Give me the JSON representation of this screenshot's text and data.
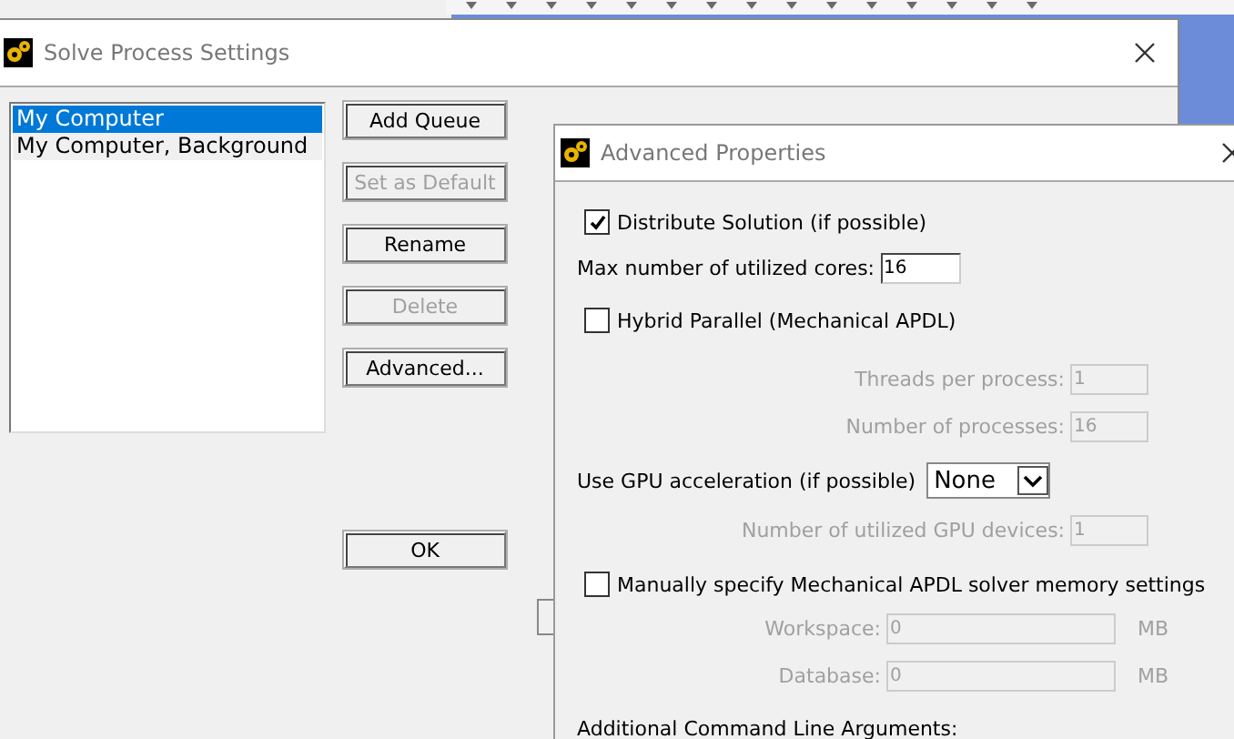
{
  "solve_dialog": {
    "title": "Solve Process Settings",
    "queues": [
      {
        "label": "My Computer",
        "selected": true
      },
      {
        "label": "My Computer, Background",
        "selected": false
      }
    ],
    "buttons": [
      {
        "label": "Add Queue",
        "disabled": false
      },
      {
        "label": "Set as Default",
        "disabled": true
      },
      {
        "label": "Rename",
        "disabled": false
      },
      {
        "label": "Delete",
        "disabled": true
      },
      {
        "label": "Advanced...",
        "disabled": false
      }
    ],
    "ok_button": "OK"
  },
  "advanced_dialog": {
    "title": "Advanced Properties",
    "distribute": {
      "label": "Distribute Solution (if possible)",
      "checked": true
    },
    "max_cores": {
      "label": "Max number of utilized cores:",
      "value": "16"
    },
    "hybrid": {
      "label": "Hybrid Parallel (Mechanical APDL)",
      "checked": false
    },
    "hybrid_fields": [
      {
        "label": "Threads per process:",
        "value": "1",
        "disabled": true
      },
      {
        "label": "Number of processes:",
        "value": "16",
        "disabled": true
      }
    ],
    "gpu": {
      "label": "Use GPU acceleration (if possible)",
      "value": "None"
    },
    "gpu_devices": {
      "label": "Number of utilized GPU devices:",
      "value": "1",
      "disabled": true
    },
    "memory": {
      "label": "Manually specify Mechanical APDL solver memory settings",
      "checked": false
    },
    "memory_fields": [
      {
        "label": "Workspace:",
        "value": "0",
        "unit": "MB",
        "disabled": true
      },
      {
        "label": "Database:",
        "value": "0",
        "unit": "MB",
        "disabled": true
      }
    ],
    "additional_args": {
      "label": "Additional Command Line Arguments:"
    }
  }
}
